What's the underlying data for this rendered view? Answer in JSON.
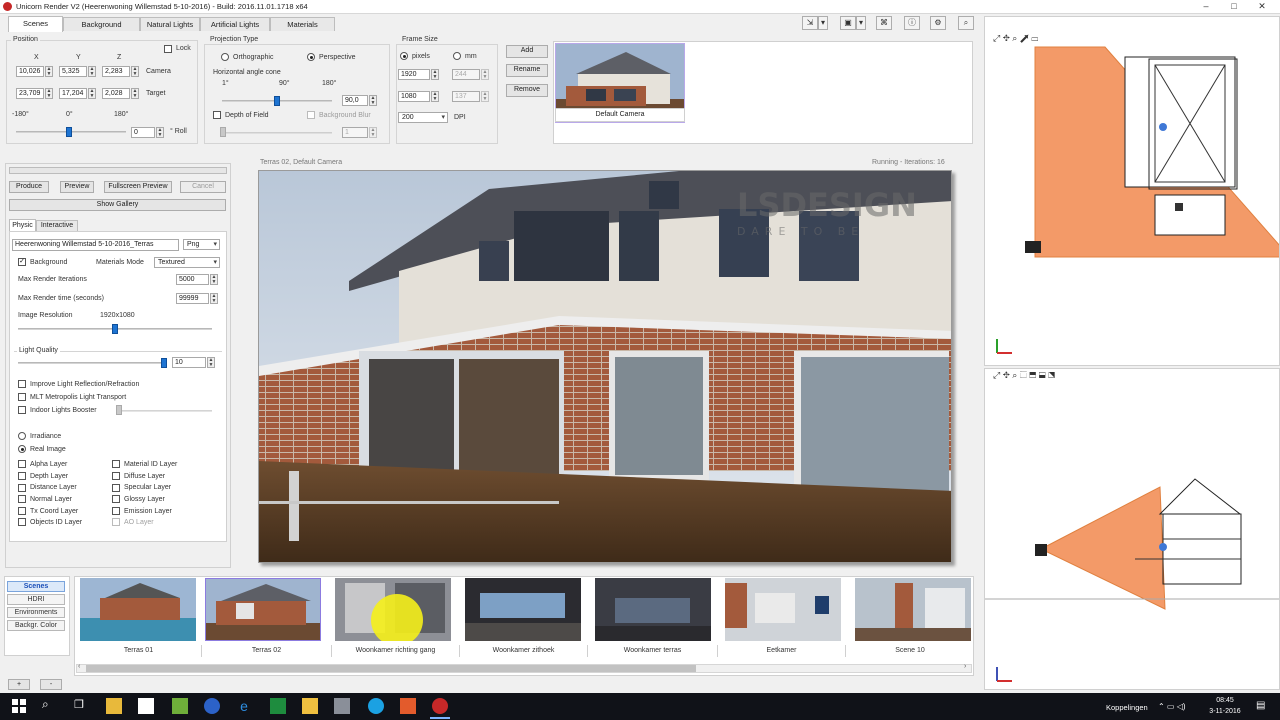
{
  "window": {
    "title": "Unicorn Render V2 (Heerenwoning Willemstad 5-10-2016) - Build: 2016.11.01.1718 x64",
    "controls": [
      "–",
      "□",
      "✕"
    ]
  },
  "tabs": [
    "Scenes",
    "Background",
    "Natural Lights",
    "Artificial Lights",
    "Materials"
  ],
  "position": {
    "title": "Position",
    "headers": [
      "X",
      "Y",
      "Z"
    ],
    "lock_label": "Lock",
    "camera_label": "Camera",
    "target_label": "Target",
    "camera": [
      "10,026",
      "5,325",
      "2,283"
    ],
    "target": [
      "23,709",
      "17,204",
      "2,028"
    ],
    "roll_ticks": [
      "-180°",
      "0°",
      "180°"
    ],
    "roll_value": "0",
    "roll_label": "° Roll"
  },
  "projection": {
    "title": "Projection Type",
    "orthographic": "Orthographic",
    "perspective": "Perspective",
    "angle_label": "Horizontal angle cone",
    "angle_ticks": [
      "1°",
      "90°",
      "180°"
    ],
    "angle_value": "90,0",
    "angle_fraction": 0.5,
    "dof_label": "Depth of Field",
    "blur_label": "Background Blur",
    "blur_value": "1"
  },
  "frame": {
    "title": "Frame Size",
    "pixels": "pixels",
    "mm": "mm",
    "width_px": "1920",
    "height_px": "1080",
    "width_mm": "244",
    "height_mm": "137",
    "dpi_value": "200",
    "dpi_label": "DPI"
  },
  "camera_buttons": [
    "Add",
    "Rename",
    "Remove"
  ],
  "camera_thumb_label": "Default Camera",
  "left": {
    "actions": [
      "Produce",
      "Preview",
      "Fullscreen Preview",
      "Cancel"
    ],
    "show_gallery": "Show Gallery",
    "subtabs": [
      "Physic",
      "Interactive"
    ],
    "filename": "Heerenwoning Willemstad 5-10-2016_Terras",
    "format": "Png",
    "background_label": "Background",
    "materials_mode_label": "Materials Mode",
    "materials_mode": "Textured",
    "max_iter_label": "Max Render Iterations",
    "max_iter": "5000",
    "max_time_label": "Max Render time (seconds)",
    "max_time": "99999",
    "res_label": "Image Resolution",
    "res_value": "1920x1080",
    "res_fraction": 0.5,
    "light_label": "Light Quality",
    "light_value": "10",
    "light_fraction": 1.0,
    "improve_label": "Improve Light Reflection/Refraction",
    "mlt_label": "MLT Metropolis Light Transport",
    "indoor_label": "Indoor Lights Booster",
    "irradiance": "Irradiance",
    "real_image": "Real Image",
    "layers_left": [
      "Alpha Layer",
      "Depth Layer",
      "Distance Layer",
      "Normal Layer",
      "Tx Coord Layer",
      "Objects ID Layer"
    ],
    "layers_right": [
      "Material ID Layer",
      "Diffuse Layer",
      "Specular Layer",
      "Glossy Layer",
      "Emission Layer",
      "AO Layer"
    ]
  },
  "viewport": {
    "caption": "Terras 02, Default Camera",
    "status": "Running - Iterations: 16",
    "watermark": "LSDESIGN",
    "watermark_sub": "DARE TO BE"
  },
  "side_nav": [
    "Scenes",
    "HDRI",
    "Environments",
    "Backgr. Color"
  ],
  "add_remove": [
    "+",
    "-"
  ],
  "scenes": [
    "Terras 01",
    "Terras 02",
    "Woonkamer richting gang",
    "Woonkamer zithoek",
    "Woonkamer terras",
    "Eetkamer",
    "Scene 10"
  ],
  "taskbar": {
    "label": "Koppelingen",
    "time": "08:45",
    "date": "3-11-2016"
  },
  "icons": {
    "search": "search-icon",
    "windows": "windows-icon",
    "settings": "gear-icon"
  },
  "colors": {
    "accent": "#1e74d2",
    "frustum": "#f39a68",
    "brick": "#a35a3c",
    "taskbar": "#101218"
  }
}
